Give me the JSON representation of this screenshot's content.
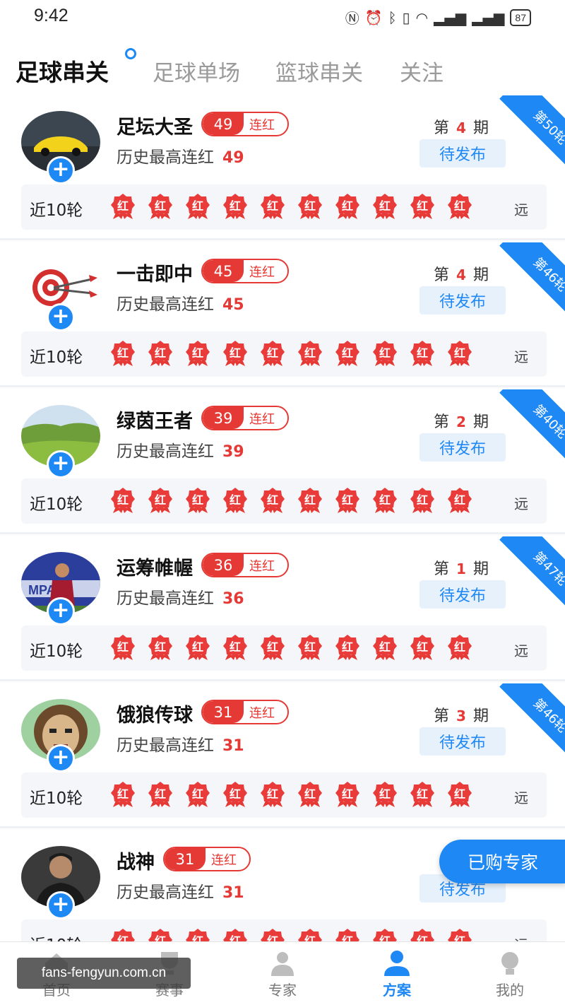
{
  "status": {
    "time": "9:42",
    "battery": "87"
  },
  "tabs": [
    {
      "label": "足球串关",
      "active": true
    },
    {
      "label": "足球单场",
      "active": false
    },
    {
      "label": "篮球串关",
      "active": false
    },
    {
      "label": "关注",
      "active": false
    }
  ],
  "common": {
    "streak_label": "连红",
    "history_prefix": "历史最高连红",
    "period_prefix": "第",
    "period_suffix": "期",
    "pending": "待发布",
    "recent_label": "近10轮",
    "badge_text": "红",
    "far_label": "远"
  },
  "experts": [
    {
      "name": "足坛大圣",
      "streak": "49",
      "history": "49",
      "period": "4",
      "round": "第50轮",
      "avatar": "car-avatar"
    },
    {
      "name": "一击即中",
      "streak": "45",
      "history": "45",
      "period": "4",
      "round": "第46轮",
      "avatar": "dart-avatar"
    },
    {
      "name": "绿茵王者",
      "streak": "39",
      "history": "39",
      "period": "2",
      "round": "第40轮",
      "avatar": "grassland-avatar"
    },
    {
      "name": "运筹帷幄",
      "streak": "36",
      "history": "36",
      "period": "1",
      "round": "第47轮",
      "avatar": "player-avatar"
    },
    {
      "name": "饿狼传球",
      "streak": "31",
      "history": "31",
      "period": "3",
      "round": "第46轮",
      "avatar": "cartoon-avatar"
    },
    {
      "name": "战神",
      "streak": "31",
      "history": "31",
      "period": "",
      "round": "",
      "avatar": "man-avatar"
    }
  ],
  "float_button": "已购专家",
  "nav": [
    {
      "label": "首页",
      "icon": "home-icon"
    },
    {
      "label": "赛事",
      "icon": "trophy-icon"
    },
    {
      "label": "专家",
      "icon": "expert-icon"
    },
    {
      "label": "方案",
      "icon": "plan-icon",
      "active": true
    },
    {
      "label": "我的",
      "icon": "profile-icon"
    }
  ],
  "watermark": "fans-fengyun.com.cn",
  "colors": {
    "accent": "#1e88f5",
    "red": "#e53935"
  }
}
